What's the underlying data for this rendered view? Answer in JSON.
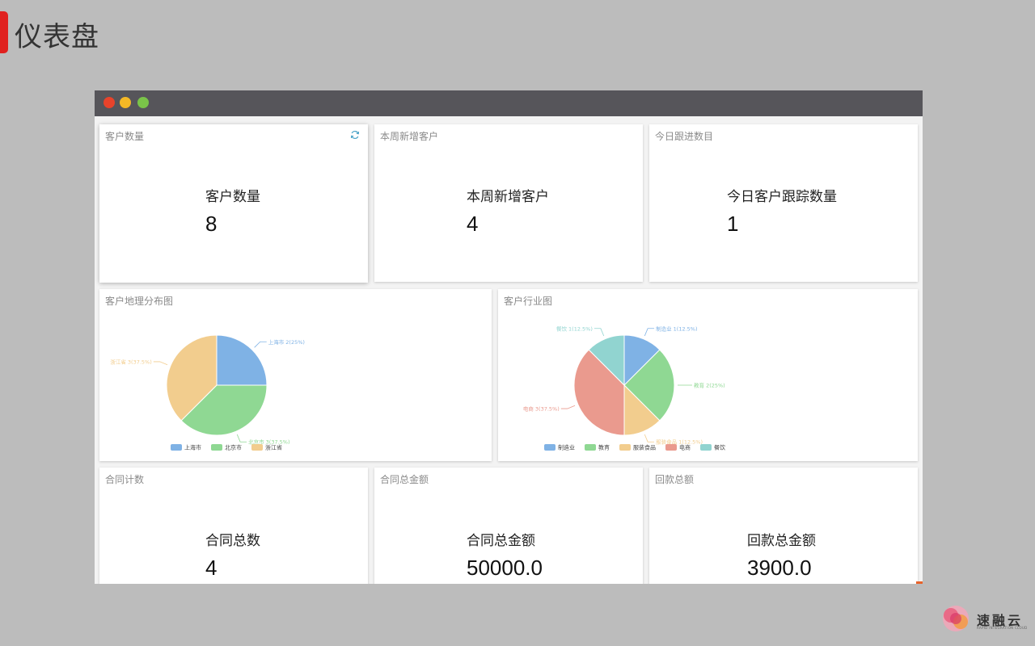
{
  "page": {
    "title": "仪表盘"
  },
  "cards": {
    "customer_count": {
      "title": "客户数量",
      "label": "客户数量",
      "value": "8"
    },
    "new_customers": {
      "title": "本周新增客户",
      "label": "本周新增客户",
      "value": "4"
    },
    "followups": {
      "title": "今日跟进数目",
      "label": "今日客户跟踪数量",
      "value": "1"
    },
    "contract_count": {
      "title": "合同计数",
      "label": "合同总数",
      "value": "4"
    },
    "contract_amount": {
      "title": "合同总金额",
      "label": "合同总金额",
      "value": "50000.0"
    },
    "payment_amount": {
      "title": "回款总额",
      "label": "回款总金额",
      "value": "3900.0"
    },
    "geo_chart": {
      "title": "客户地理分布图"
    },
    "industry_chart": {
      "title": "客户行业图"
    }
  },
  "chart_data": [
    {
      "type": "pie",
      "title": "客户地理分布图",
      "categories": [
        "上海市",
        "北京市",
        "浙江省"
      ],
      "values": [
        2,
        3,
        3
      ],
      "labels": [
        "上海市 2(25%)",
        "北京市 3(37.5%)",
        "浙江省 3(37.5%)"
      ],
      "colors": [
        "#7fb2e5",
        "#8fd893",
        "#f2cd8e"
      ],
      "legend": "bottom"
    },
    {
      "type": "pie",
      "title": "客户行业图",
      "categories": [
        "制造业",
        "教育",
        "服装食品",
        "电商",
        "餐饮"
      ],
      "values": [
        1,
        2,
        1,
        3,
        1
      ],
      "labels": [
        "制造业 1(12.5%)",
        "教育 2(25%)",
        "服装食品 1(12.5%)",
        "电商 3(37.5%)",
        "餐饮 1(12.5%)"
      ],
      "colors": [
        "#7fb2e5",
        "#8fd893",
        "#f2cd8e",
        "#ea9a8e",
        "#91d4d0"
      ],
      "legend": "bottom"
    }
  ],
  "brand": {
    "name": "速融云",
    "tagline": "RAPID INTEGRATION CLOUD"
  },
  "colors": {
    "accent": "#e0211f",
    "window_bar": "#56555a"
  }
}
